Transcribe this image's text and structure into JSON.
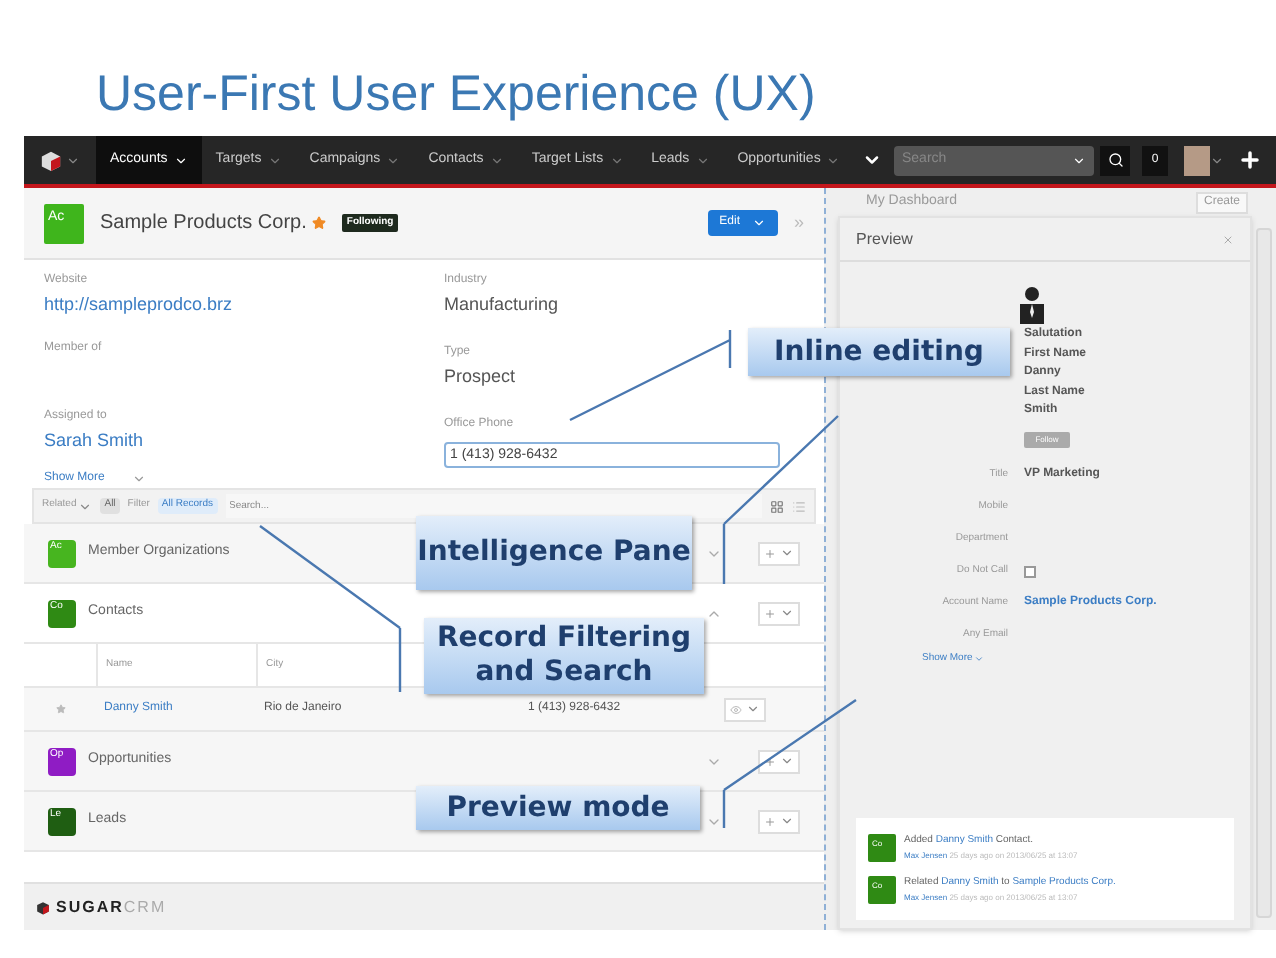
{
  "slide_title": "User-First User Experience (UX)",
  "nav": {
    "items": [
      {
        "label": "Accounts",
        "selected": true
      },
      {
        "label": "Targets",
        "selected": false
      },
      {
        "label": "Campaigns",
        "selected": false
      },
      {
        "label": "Contacts",
        "selected": false
      },
      {
        "label": "Target Lists",
        "selected": false
      },
      {
        "label": "Leads",
        "selected": false
      },
      {
        "label": "Opportunities",
        "selected": false
      }
    ],
    "search_placeholder": "Search",
    "notifications": "0"
  },
  "record": {
    "badge": "Ac",
    "name": "Sample Products Corp.",
    "favorite": true,
    "following": "Following",
    "edit": "Edit",
    "collapse": "»",
    "fields_left": [
      {
        "label": "Website",
        "value": "http://sampleprodco.brz",
        "kind": "link"
      },
      {
        "label": "Member of",
        "kind": "text"
      },
      {
        "label": "Assigned to",
        "value": "Sarah Smith",
        "kind": "link"
      }
    ],
    "fields_right": [
      {
        "label": "Industry",
        "value": "Manufacturing",
        "kind": "text"
      },
      {
        "label": "Type",
        "value": "Prospect",
        "kind": "text"
      },
      {
        "label": "Office Phone",
        "value": "1 (413) 928-6432",
        "kind": "edit"
      }
    ],
    "show_more": "Show More"
  },
  "filter": {
    "related": "Related",
    "all": "All",
    "filter": "Filter",
    "records": "All Records",
    "placeholder": "Search..."
  },
  "subpanels": [
    {
      "badge": "Ac",
      "color": "#47b51f",
      "title": "Member Organizations",
      "expanded": false
    },
    {
      "badge": "Co",
      "color": "#2f8a14",
      "title": "Contacts",
      "expanded": true,
      "columns": [
        "Name",
        "City"
      ],
      "rows": [
        {
          "name": "Danny Smith",
          "city": "Rio de Janeiro",
          "phone": "1 (413) 928-6432"
        }
      ]
    },
    {
      "badge": "Op",
      "color": "#8f1cc4",
      "title": "Opportunities",
      "expanded": false
    },
    {
      "badge": "Le",
      "color": "#1f5e12",
      "title": "Leads",
      "expanded": false
    }
  ],
  "footer": {
    "logo_bold": "SUGAR",
    "logo_light": "CRM"
  },
  "dashboard": {
    "title": "My Dashboard",
    "create": "Create"
  },
  "preview": {
    "title": "Preview",
    "name_block": [
      "Salutation",
      "First Name",
      "Danny",
      "Last Name",
      "Smith"
    ],
    "follow": "Follow",
    "fields": [
      {
        "label": "Title",
        "value": "VP Marketing",
        "kind": "text"
      },
      {
        "label": "Mobile",
        "kind": "text"
      },
      {
        "label": "Department",
        "kind": "text"
      },
      {
        "label": "Do Not Call",
        "kind": "checkbox",
        "checked": false
      },
      {
        "label": "Account Name",
        "value": "Sample Products Corp.",
        "kind": "link"
      },
      {
        "label": "Any Email",
        "kind": "text"
      }
    ],
    "show_more": "Show More"
  },
  "activity": [
    {
      "badge": "Co",
      "parts": [
        {
          "text": "Added ",
          "link": false
        },
        {
          "text": "Danny Smith",
          "link": true
        },
        {
          "text": " Contact.",
          "link": false
        }
      ],
      "author": "Max Jensen",
      "meta": "25 days ago on 2013/06/25 at 13:07"
    },
    {
      "badge": "Co",
      "parts": [
        {
          "text": "Related ",
          "link": false
        },
        {
          "text": "Danny Smith",
          "link": true
        },
        {
          "text": " to ",
          "link": false
        },
        {
          "text": "Sample Products Corp.",
          "link": true
        }
      ],
      "author": "Max Jensen",
      "meta": "25 days ago on 2013/06/25 at 13:07"
    }
  ],
  "callouts": [
    "Inline editing",
    "Intelligence Pane",
    "Record Filtering and Search",
    "Preview mode"
  ]
}
